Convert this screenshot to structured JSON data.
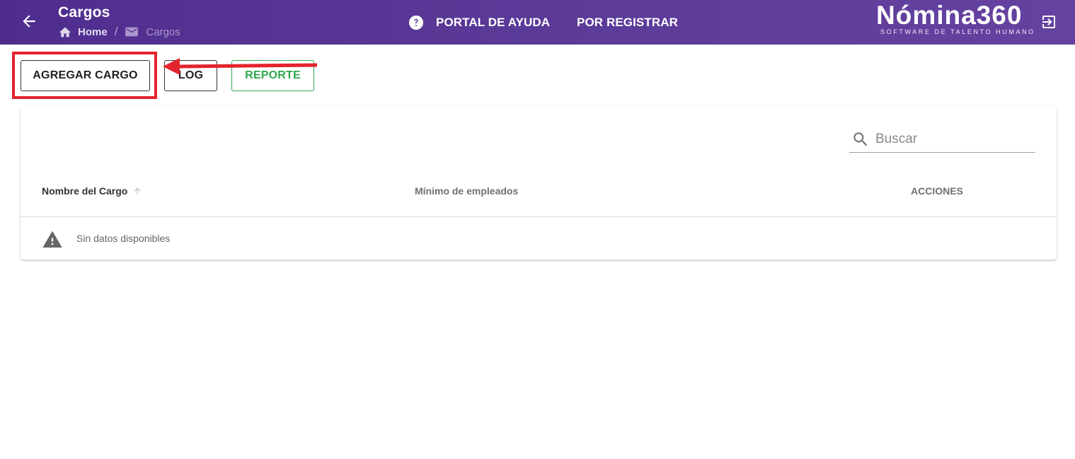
{
  "header": {
    "title": "Cargos",
    "breadcrumb": {
      "home": "Home",
      "current": "Cargos"
    },
    "nav": {
      "help": "PORTAL DE AYUDA",
      "register": "POR REGISTRAR"
    },
    "logo": {
      "main": "Nómina360",
      "sub": "SOFTWARE DE TALENTO HUMANO"
    },
    "icons": [
      "back-arrow-icon",
      "home-icon",
      "mail-icon",
      "help-circle-icon",
      "logout-icon"
    ]
  },
  "toolbar": {
    "add_label": "AGREGAR CARGO",
    "log_label": "LOG",
    "report_label": "REPORTE"
  },
  "table": {
    "search_placeholder": "Buscar",
    "columns": [
      "Nombre del Cargo",
      "Mínimo de empleados",
      "ACCIONES"
    ],
    "empty_text": "Sin datos disponibles"
  },
  "colors": {
    "header_bg": "#5b3a98",
    "report_green": "#2fa84f",
    "annotation_red": "#e3232b"
  }
}
